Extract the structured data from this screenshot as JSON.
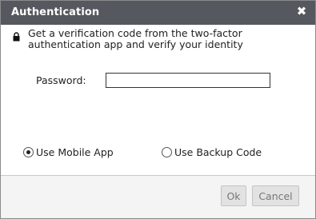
{
  "dialog": {
    "title": "Authentication",
    "close_symbol": "✖",
    "info_text": "Get a verification code from the two-factor authentication app and verify your identity",
    "info_icon": "lock-icon"
  },
  "form": {
    "password_label": "Password:",
    "password_value": ""
  },
  "options": {
    "mobile_app_label": "Use Mobile App",
    "mobile_app_selected": true,
    "backup_code_label": "Use Backup Code",
    "backup_code_selected": false
  },
  "buttons": {
    "ok_label": "Ok",
    "cancel_label": "Cancel"
  },
  "colors": {
    "titlebar": "#55585e",
    "button_bg": "#e2e2e2",
    "button_text": "#777777"
  }
}
